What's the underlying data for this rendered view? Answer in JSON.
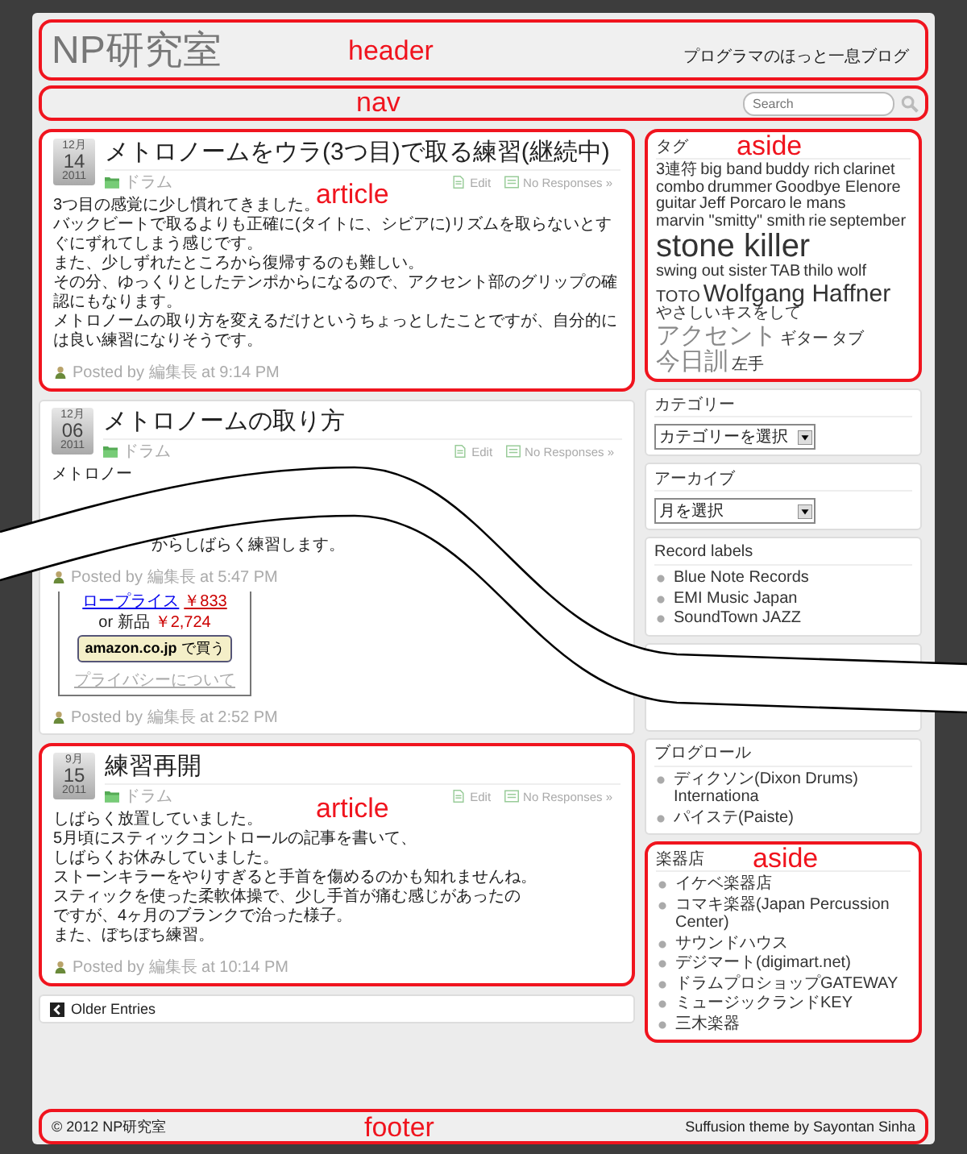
{
  "site": {
    "title": "NP研究室",
    "tagline": "プログラマのほっと一息ブログ",
    "annotation": "header"
  },
  "nav": {
    "annotation": "nav",
    "search": {
      "placeholder": "Search"
    }
  },
  "articles": [
    {
      "annotation": "article",
      "month": "12月",
      "day": "14",
      "year": "2011",
      "title": "メトロノームをウラ(3つ目)で取る練習(継続中)",
      "category": "ドラム",
      "edit": "Edit",
      "responses": "No Responses »",
      "body": [
        {
          "kind": "plain",
          "text": "3つ目の感覚に少し慣れてきました。"
        },
        {
          "kind": "plain",
          "text": "バックビートで取るよりも正確に(タイトに、シビアに)リズムを取らないとすぐにずれてしまう感じです。"
        },
        {
          "kind": "plain",
          "text": "また、少しずれたところから復帰するのも難しい。"
        },
        {
          "kind": "plain",
          "text": "その分、ゆっくりとしたテンポからになるので、アクセント部のグリップの確認にもなります。"
        },
        {
          "kind": "plain",
          "text": "メトロノームの取り方を変えるだけというちょっとしたことですが、自分的には良い練習になりそうです。"
        }
      ],
      "extras": [
        {
          "kind": "byline",
          "text": "Posted by 編集長 at 9:14 PM"
        }
      ]
    },
    {
      "month": "12月",
      "day": "06",
      "year": "2011",
      "title": "メトロノームの取り方",
      "category": "ドラム",
      "edit": "Edit",
      "responses": "No Responses »",
      "body": [
        {
          "kind": "plain",
          "text": "メトロノー"
        },
        {
          "kind": "cut",
          "text": "からしばらく練習します。"
        }
      ],
      "extras": [
        {
          "kind": "byline",
          "text": "Posted by 編集長 at 5:47 PM"
        },
        {
          "kind": "ad",
          "low_label": "ロープライス",
          "low_price": "￥833",
          "new_label": "or 新品",
          "new_price": "￥2,724",
          "button": "amazon.co.jp",
          "button_sub": "で買う",
          "privacy": "プライバシーについて"
        },
        {
          "kind": "byline",
          "text": "Posted by 編集長 at 2:52 PM"
        }
      ]
    },
    {
      "annotation": "article",
      "month": "9月",
      "day": "15",
      "year": "2011",
      "title": "練習再開",
      "category": "ドラム",
      "edit": "Edit",
      "responses": "No Responses »",
      "body": [
        {
          "kind": "plain",
          "text": "しばらく放置していました。"
        },
        {
          "kind": "plain",
          "text": "5月頃にスティックコントロールの記事を書いて、"
        },
        {
          "kind": "plain",
          "text": "しばらくお休みしていました。"
        },
        {
          "kind": "plain",
          "text": "ストーンキラーをやりすぎると手首を傷めるのかも知れませんね。"
        },
        {
          "kind": "plain",
          "text": "スティックを使った柔軟体操で、少し手首が痛む感じがあったの"
        },
        {
          "kind": "plain",
          "text": "ですが、4ヶ月のブランクで治った様子。"
        },
        {
          "kind": "plain",
          "text": "また、ぼちぼち練習。"
        }
      ],
      "extras": [
        {
          "kind": "byline",
          "text": "Posted by 編集長 at 10:14 PM"
        }
      ]
    }
  ],
  "older": "Older Entries",
  "sidebar": [
    {
      "kind": "tags",
      "title": "タグ",
      "annotation": "aside",
      "tags": [
        {
          "text": "3連符",
          "kind": "small",
          "faded": false
        },
        {
          "text": "big band",
          "kind": "small",
          "faded": false
        },
        {
          "text": "buddy rich",
          "kind": "small",
          "faded": false
        },
        {
          "text": "clarinet",
          "kind": "small",
          "faded": false
        },
        {
          "text": "combo",
          "kind": "small",
          "faded": false
        },
        {
          "text": "drummer",
          "kind": "small",
          "faded": false
        },
        {
          "text": "Goodbye Elenore",
          "kind": "small",
          "faded": false
        },
        {
          "text": "guitar",
          "kind": "small",
          "faded": false
        },
        {
          "text": "Jeff Porcaro",
          "kind": "small",
          "faded": false
        },
        {
          "text": "le mans",
          "kind": "small",
          "faded": false
        },
        {
          "text": "marvin \"smitty\" smith",
          "kind": "small",
          "faded": false
        },
        {
          "text": "rie",
          "kind": "small",
          "faded": false
        },
        {
          "text": "september",
          "kind": "small",
          "faded": false
        },
        {
          "text": "stone killer",
          "kind": "huge",
          "faded": false
        },
        {
          "text": "swing out sister",
          "kind": "small",
          "faded": false
        },
        {
          "text": "TAB",
          "kind": "small",
          "faded": false
        },
        {
          "text": "thilo wolf",
          "kind": "small",
          "faded": false
        },
        {
          "text": "TOTO",
          "kind": "small",
          "faded": false
        },
        {
          "text": "Wolfgang Haffner",
          "kind": "large",
          "faded": false
        },
        {
          "text": "やさしいキスをして",
          "kind": "small",
          "faded": false
        },
        {
          "text": "アクセント",
          "kind": "large",
          "faded": true
        },
        {
          "text": "ギター",
          "kind": "small",
          "faded": false
        },
        {
          "text": "タブ",
          "kind": "small",
          "faded": false
        },
        {
          "text": "今日訓",
          "kind": "large",
          "faded": true
        },
        {
          "text": "左手",
          "kind": "small",
          "faded": false
        }
      ]
    },
    {
      "kind": "select",
      "title": "カテゴリー",
      "value": "カテゴリーを選択"
    },
    {
      "kind": "select",
      "title": "アーカイブ",
      "value": "月を選択"
    },
    {
      "kind": "links",
      "title": "Record labels",
      "items": [
        "Blue Note Records",
        "EMI Music Japan",
        "SoundTown JAZZ"
      ]
    },
    {
      "kind": "blank"
    },
    {
      "kind": "links",
      "title": "ブログロール",
      "items": [
        "ディクソン(Dixon Drums) Internationa",
        "パイステ(Paiste)"
      ]
    },
    {
      "kind": "links",
      "title": "楽器店",
      "annotation": "aside",
      "items": [
        "イケベ楽器店",
        "コマキ楽器(Japan Percussion Center)",
        "サウンドハウス",
        "デジマート(digimart.net)",
        "ドラムプロショップGATEWAY",
        "ミュージックランドKEY",
        "三木楽器"
      ]
    }
  ],
  "footer": {
    "annotation": "footer",
    "copyright": "© 2012 NP研究室",
    "credit": "Suffusion theme by Sayontan Sinha"
  }
}
